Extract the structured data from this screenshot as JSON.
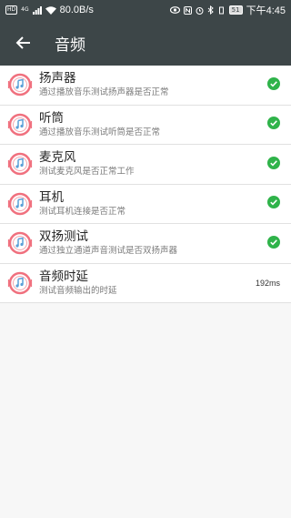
{
  "status_bar": {
    "hd": "HD",
    "network": "4G",
    "speed": "80.0B/s",
    "battery": "51",
    "time": "下午4:45"
  },
  "header": {
    "title": "音频"
  },
  "items": [
    {
      "title": "扬声器",
      "subtitle": "通过播放音乐测试扬声器是否正常",
      "status": "pass",
      "icon": "audio-test-icon"
    },
    {
      "title": "听筒",
      "subtitle": "通过播放音乐测试听筒是否正常",
      "status": "pass",
      "icon": "audio-test-icon"
    },
    {
      "title": "麦克风",
      "subtitle": "测试麦克风是否正常工作",
      "status": "pass",
      "icon": "audio-test-icon"
    },
    {
      "title": "耳机",
      "subtitle": "测试耳机连接是否正常",
      "status": "pass",
      "icon": "audio-test-icon"
    },
    {
      "title": "双扬测试",
      "subtitle": "通过独立通道声音测试是否双扬声器",
      "status": "pass",
      "icon": "audio-test-icon"
    },
    {
      "title": "音频时延",
      "subtitle": "测试音频输出的时延",
      "value": "192ms",
      "icon": "audio-test-icon"
    }
  ],
  "colors": {
    "bar": "#3d4648",
    "check": "#2fb34a",
    "icon_ring": "#f0707e",
    "icon_accent": "#5aa0d8"
  }
}
